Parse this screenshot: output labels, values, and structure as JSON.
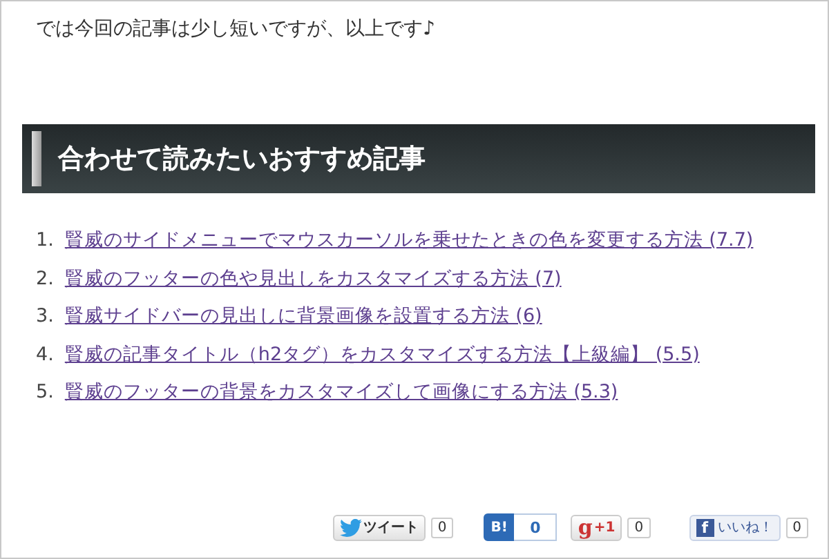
{
  "intro": "では今回の記事は少し短いですが、以上です♪",
  "heading": "合わせて読みたいおすすめ記事",
  "articles": [
    {
      "number": "1.",
      "title": "賢威のサイドメニューでマウスカーソルを乗せたときの色を変更する方法 (7.7)"
    },
    {
      "number": "2.",
      "title": "賢威のフッターの色や見出しをカスタマイズする方法 (7)"
    },
    {
      "number": "3.",
      "title": "賢威サイドバーの見出しに背景画像を設置する方法 (6)"
    },
    {
      "number": "4.",
      "title": "賢威の記事タイトル（h2タグ）をカスタマイズする方法【上級編】 (5.5)"
    },
    {
      "number": "5.",
      "title": "賢威のフッターの背景をカスタマイズして画像にする方法 (5.3)"
    }
  ],
  "share": [
    {
      "kind": "tweet",
      "label": "ツイート",
      "count": "0"
    },
    {
      "kind": "hatena",
      "label": "B!",
      "count": "0"
    },
    {
      "kind": "gplus",
      "logo": "g",
      "label": "+1",
      "count": "0"
    },
    {
      "kind": "like",
      "logo": "f",
      "label": "いいね！",
      "count": "0"
    }
  ]
}
